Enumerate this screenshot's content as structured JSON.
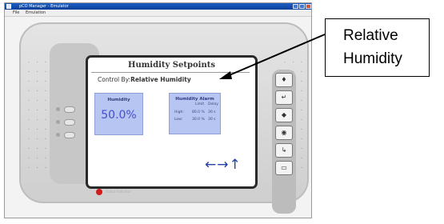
{
  "window": {
    "title": "pCO Manager - Emulator",
    "menu": [
      "File",
      "Emulation"
    ]
  },
  "screen": {
    "title": "Humidity Setpoints",
    "control_by_label": "Control By:",
    "control_by_value": "Relative Humidity",
    "humidity": {
      "label": "Humidity",
      "value": "50.0%"
    },
    "alarm": {
      "title": "Humidity Alarm",
      "col_limit": "Limit",
      "col_delay": "Delay",
      "rows": [
        {
          "label": "High:",
          "limit": "80.0 %",
          "delay": "30 s"
        },
        {
          "label": "Low:",
          "limit": "30.0 %",
          "delay": "30 s"
        }
      ]
    },
    "nav_arrows": "←→↑",
    "status_text": "Status Indicator"
  },
  "keypad": {
    "icons": [
      "alarm-key-icon",
      "prg-key-icon",
      "esc-key-icon",
      "up-key-icon",
      "enter-key-icon",
      "down-key-icon"
    ],
    "glyphs": [
      "♦",
      "↵",
      "◆",
      "◉",
      "↳",
      "▭"
    ]
  },
  "callout": {
    "line1": "Relative",
    "line2": "Humidity"
  }
}
